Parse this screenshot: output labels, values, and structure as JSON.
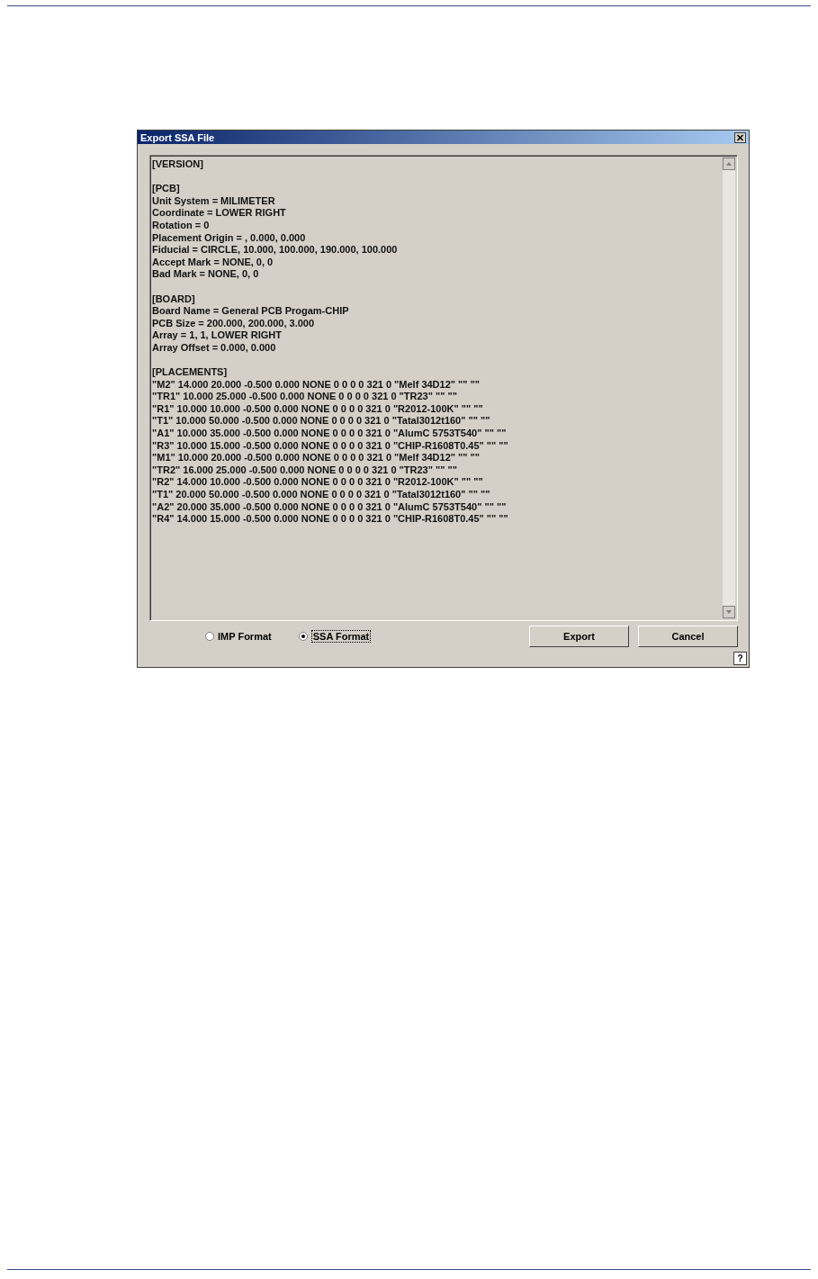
{
  "window": {
    "title": "Export SSA File"
  },
  "file_text": {
    "sections": [
      {
        "lines": [
          "[VERSION]"
        ]
      },
      {
        "lines": [
          "[PCB]",
          "Unit System = MILIMETER",
          "Coordinate = LOWER RIGHT",
          "Rotation = 0",
          "Placement Origin = , 0.000, 0.000",
          "Fiducial = CIRCLE, 10.000, 100.000, 190.000, 100.000",
          "Accept Mark = NONE, 0, 0",
          "Bad Mark = NONE, 0, 0"
        ]
      },
      {
        "lines": [
          "[BOARD]",
          "Board Name = General PCB Progam-CHIP",
          "PCB Size = 200.000, 200.000, 3.000",
          "Array = 1, 1, LOWER RIGHT",
          "Array Offset = 0.000, 0.000"
        ]
      },
      {
        "lines": [
          "[PLACEMENTS]",
          "\"M2\" 14.000 20.000 -0.500 0.000 NONE 0 0 0 0 321 0 \"Melf 34D12\" \"\" \"\"",
          "\"TR1\" 10.000 25.000 -0.500 0.000 NONE 0 0 0 0 321 0 \"TR23\" \"\" \"\"",
          "\"R1\" 10.000 10.000 -0.500 0.000 NONE 0 0 0 0 321 0 \"R2012-100K\" \"\" \"\"",
          "\"T1\" 10.000 50.000 -0.500 0.000 NONE 0 0 0 0 321 0 \"Tatal3012t160\" \"\" \"\"",
          "\"A1\" 10.000 35.000 -0.500 0.000 NONE 0 0 0 0 321 0 \"AlumC 5753T540\" \"\" \"\"",
          "\"R3\" 10.000 15.000 -0.500 0.000 NONE 0 0 0 0 321 0 \"CHIP-R1608T0.45\" \"\" \"\"",
          "\"M1\" 10.000 20.000 -0.500 0.000 NONE 0 0 0 0 321 0 \"Melf 34D12\" \"\" \"\"",
          "\"TR2\" 16.000 25.000 -0.500 0.000 NONE 0 0 0 0 321 0 \"TR23\" \"\" \"\"",
          "\"R2\" 14.000 10.000 -0.500 0.000 NONE 0 0 0 0 321 0 \"R2012-100K\" \"\" \"\"",
          "\"T1\" 20.000 50.000 -0.500 0.000 NONE 0 0 0 0 321 0 \"Tatal3012t160\" \"\" \"\"",
          "\"A2\" 20.000 35.000 -0.500 0.000 NONE 0 0 0 0 321 0 \"AlumC 5753T540\" \"\" \"\"",
          "\"R4\" 14.000 15.000 -0.500 0.000 NONE 0 0 0 0 321 0 \"CHIP-R1608T0.45\" \"\" \"\""
        ]
      }
    ]
  },
  "format_options": [
    {
      "label": "IMP Format",
      "selected": false
    },
    {
      "label": "SSA Format",
      "selected": true
    }
  ],
  "buttons": [
    "Export",
    "Cancel"
  ],
  "help_button": "?"
}
